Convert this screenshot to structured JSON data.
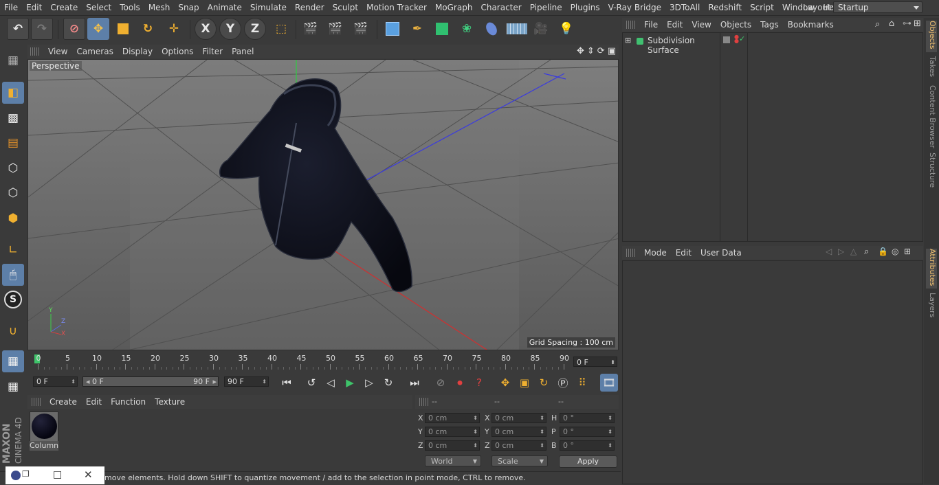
{
  "menubar": {
    "items": [
      "File",
      "Edit",
      "Create",
      "Select",
      "Tools",
      "Mesh",
      "Snap",
      "Animate",
      "Simulate",
      "Render",
      "Sculpt",
      "Motion Tracker",
      "MoGraph",
      "Character",
      "Pipeline",
      "Plugins",
      "V-Ray Bridge",
      "3DToAll",
      "Redshift",
      "Script",
      "Window",
      "Help"
    ],
    "layout_label": "Layout:",
    "layout_value": "Startup"
  },
  "toolbar": {
    "axis_x": "X",
    "axis_y": "Y",
    "axis_z": "Z"
  },
  "viewport": {
    "menu": [
      "View",
      "Cameras",
      "Display",
      "Options",
      "Filter",
      "Panel"
    ],
    "label": "Perspective",
    "grid_spacing": "Grid Spacing : 100 cm",
    "axis_labels": {
      "x": "X",
      "y": "Y",
      "z": "Z"
    }
  },
  "timeline": {
    "ticks": [
      "0",
      "5",
      "10",
      "15",
      "20",
      "25",
      "30",
      "35",
      "40",
      "45",
      "50",
      "55",
      "60",
      "65",
      "70",
      "75",
      "80",
      "85",
      "90"
    ],
    "current_frame": "0 F"
  },
  "transport": {
    "start_field": "0 F",
    "range_start": "0 F",
    "range_end": "90 F",
    "end_field": "90 F"
  },
  "material_manager": {
    "menu": [
      "Create",
      "Edit",
      "Function",
      "Texture"
    ],
    "material_name": "Column"
  },
  "coordinates": {
    "headers": [
      "--",
      "--",
      "--"
    ],
    "rows": [
      {
        "l1": "X",
        "v1": "0 cm",
        "l2": "X",
        "v2": "0 cm",
        "l3": "H",
        "v3": "0 °"
      },
      {
        "l1": "Y",
        "v1": "0 cm",
        "l2": "Y",
        "v2": "0 cm",
        "l3": "P",
        "v3": "0 °"
      },
      {
        "l1": "Z",
        "v1": "0 cm",
        "l2": "Z",
        "v2": "0 cm",
        "l3": "B",
        "v3": "0 °"
      }
    ],
    "mode_dropdown": "World",
    "scale_dropdown": "Scale",
    "apply": "Apply"
  },
  "object_manager": {
    "menu": [
      "File",
      "Edit",
      "View",
      "Objects",
      "Tags",
      "Bookmarks"
    ],
    "objects": [
      {
        "name": "Subdivision Surface"
      }
    ]
  },
  "attribute_manager": {
    "menu": [
      "Mode",
      "Edit",
      "User Data"
    ]
  },
  "right_tabs": [
    "Objects",
    "Takes",
    "Content Browser",
    "Structure",
    "Attributes",
    "Layers"
  ],
  "brand": {
    "maxon": "MAXON",
    "product": "CINEMA 4D"
  },
  "status_text": "move elements. Hold down SHIFT to quantize movement / add to the selection in point mode, CTRL to remove.",
  "colors": {
    "accent": "#5d7fa8",
    "panel": "#3a3a3a",
    "viewport": "#6a6a6a"
  }
}
